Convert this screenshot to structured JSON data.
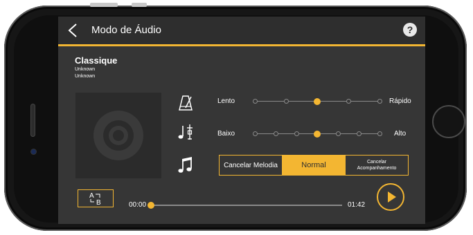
{
  "header": {
    "title": "Modo de Áudio",
    "help_label": "?"
  },
  "song": {
    "title": "Classique",
    "artist": "Unknown",
    "album": "Unknown"
  },
  "tempo": {
    "left_label": "Lento",
    "right_label": "Rápido",
    "stops": 5,
    "selected_index": 2
  },
  "key": {
    "left_label": "Baixo",
    "right_label": "Alto",
    "stops": 7,
    "selected_index": 3
  },
  "part": {
    "options": [
      "Cancelar Melodia",
      "Normal",
      "Cancelar Acompanhamento"
    ],
    "selected_index": 1
  },
  "playback": {
    "current_time": "00:00",
    "total_time": "01:42",
    "progress": 0.0
  },
  "colors": {
    "accent": "#f3b632",
    "background": "#363636",
    "header": "#2e2e2e",
    "text": "#ffffff"
  },
  "icons": {
    "back": "chevron-left-icon",
    "help": "help-icon",
    "tempo": "metronome-icon",
    "key": "key-transpose-icon",
    "part": "music-note-icon",
    "ab_repeat": "ab-repeat-icon",
    "play": "play-icon"
  }
}
